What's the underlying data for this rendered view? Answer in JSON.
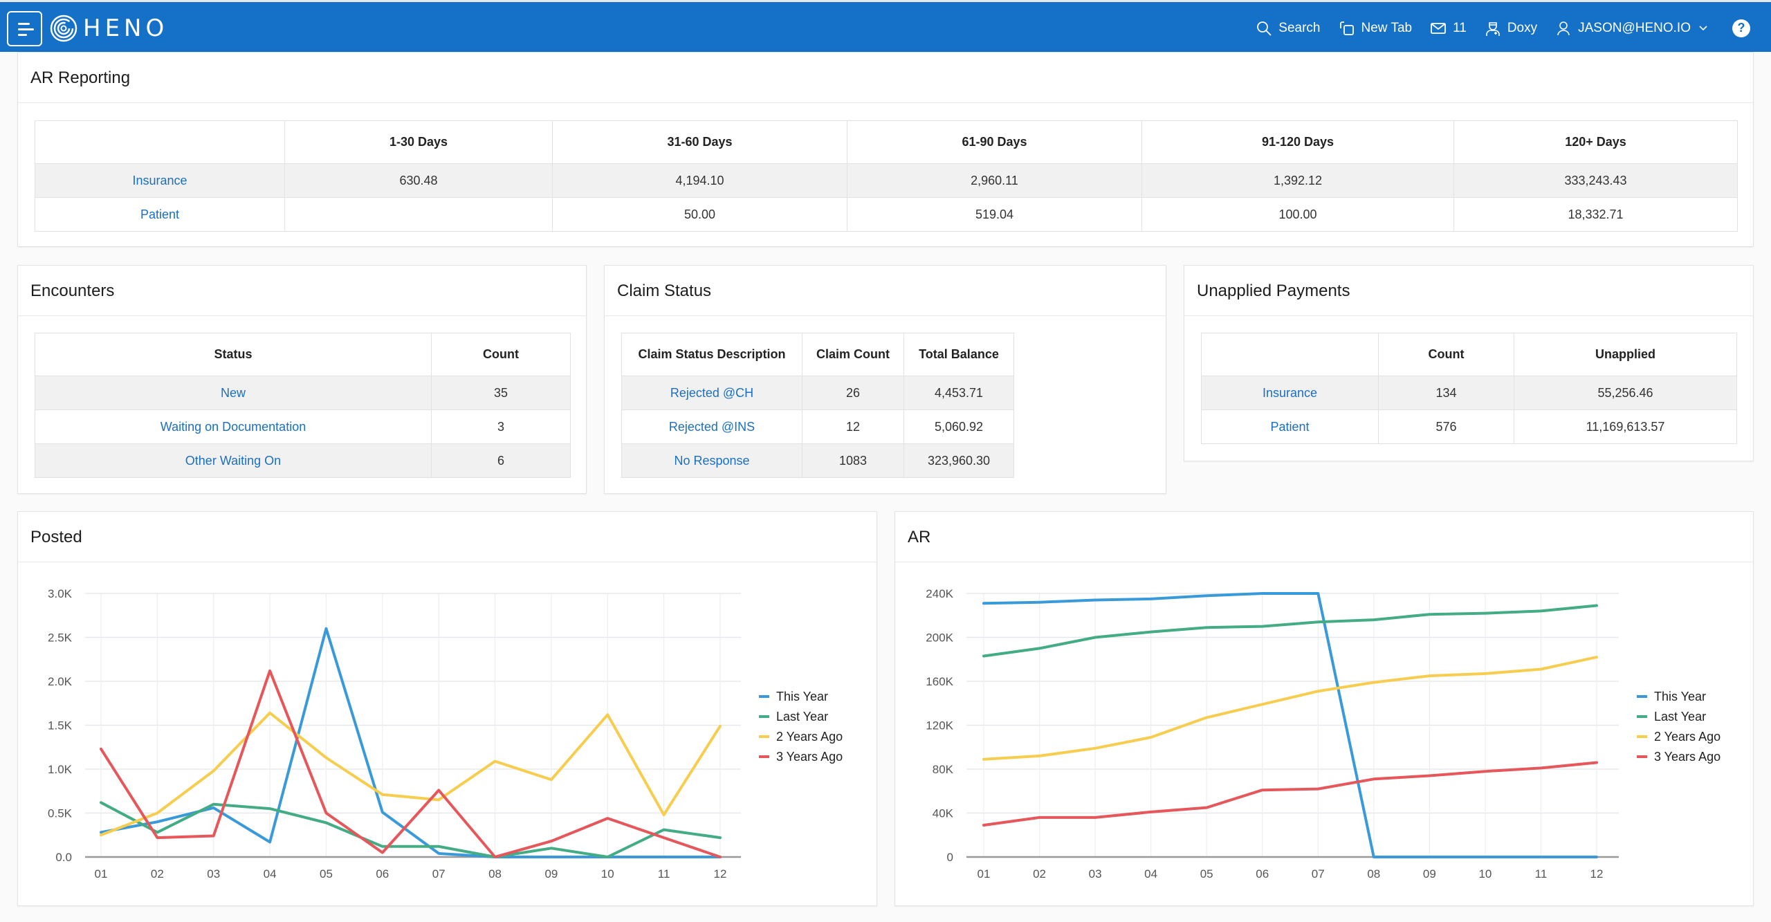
{
  "header": {
    "brand": "HENO",
    "nav": {
      "search": "Search",
      "new_tab": "New Tab",
      "messages_count": "11",
      "doxy": "Doxy",
      "user": "JASON@HENO.IO",
      "help": "?"
    },
    "brand_color": "#1570c7"
  },
  "ar_reporting": {
    "title": "AR Reporting",
    "columns": [
      "",
      "1-30 Days",
      "31-60 Days",
      "61-90 Days",
      "91-120 Days",
      "120+ Days"
    ],
    "rows": [
      {
        "label": "Insurance",
        "values": [
          "630.48",
          "4,194.10",
          "2,960.11",
          "1,392.12",
          "333,243.43"
        ]
      },
      {
        "label": "Patient",
        "values": [
          "",
          "50.00",
          "519.04",
          "100.00",
          "18,332.71"
        ]
      }
    ]
  },
  "encounters": {
    "title": "Encounters",
    "columns": [
      "Status",
      "Count"
    ],
    "rows": [
      {
        "status": "New",
        "count": "35"
      },
      {
        "status": "Waiting on Documentation",
        "count": "3"
      },
      {
        "status": "Other Waiting On",
        "count": "6"
      }
    ]
  },
  "claim_status": {
    "title": "Claim Status",
    "columns": [
      "Claim Status Description",
      "Claim Count",
      "Total Balance"
    ],
    "rows": [
      {
        "description": "Rejected @CH",
        "count": "26",
        "balance": "4,453.71"
      },
      {
        "description": "Rejected @INS",
        "count": "12",
        "balance": "5,060.92"
      },
      {
        "description": "No Response",
        "count": "1083",
        "balance": "323,960.30"
      }
    ]
  },
  "unapplied_payments": {
    "title": "Unapplied Payments",
    "columns": [
      "",
      "Count",
      "Unapplied"
    ],
    "rows": [
      {
        "label": "Insurance",
        "count": "134",
        "unapplied": "55,256.46"
      },
      {
        "label": "Patient",
        "count": "576",
        "unapplied": "11,169,613.57"
      }
    ]
  },
  "chart_data": [
    {
      "id": "posted",
      "type": "line",
      "title": "Posted",
      "xlabel": "",
      "ylabel": "",
      "x": [
        "01",
        "02",
        "03",
        "04",
        "05",
        "06",
        "07",
        "08",
        "09",
        "10",
        "11",
        "12"
      ],
      "ylim": [
        0,
        3000
      ],
      "yticks": [
        0,
        500,
        1000,
        1500,
        2000,
        2500,
        3000
      ],
      "ytick_labels": [
        "0.0",
        "0.5K",
        "1.0K",
        "1.5K",
        "2.0K",
        "2.5K",
        "3.0K"
      ],
      "grid": true,
      "legend_position": "right",
      "series": [
        {
          "name": "This Year",
          "color": "#3a9ad9",
          "values": [
            280,
            400,
            560,
            170,
            2600,
            510,
            40,
            0,
            0,
            0,
            0,
            0
          ]
        },
        {
          "name": "Last Year",
          "color": "#43ac84",
          "values": [
            620,
            280,
            600,
            550,
            390,
            120,
            120,
            0,
            100,
            0,
            310,
            220
          ]
        },
        {
          "name": "2 Years Ago",
          "color": "#f7cd50",
          "values": [
            250,
            500,
            980,
            1640,
            1130,
            710,
            650,
            1090,
            880,
            1620,
            480,
            1490
          ]
        },
        {
          "name": "3 Years Ago",
          "color": "#e5575a",
          "values": [
            1230,
            220,
            240,
            2120,
            500,
            50,
            760,
            0,
            180,
            440,
            220,
            0
          ]
        }
      ]
    },
    {
      "id": "ar",
      "type": "line",
      "title": "AR",
      "xlabel": "",
      "ylabel": "",
      "x": [
        "01",
        "02",
        "03",
        "04",
        "05",
        "06",
        "07",
        "08",
        "09",
        "10",
        "11",
        "12"
      ],
      "ylim": [
        0,
        240000
      ],
      "yticks": [
        0,
        40000,
        80000,
        120000,
        160000,
        200000,
        240000
      ],
      "ytick_labels": [
        "0",
        "40K",
        "80K",
        "120K",
        "160K",
        "200K",
        "240K"
      ],
      "grid": true,
      "legend_position": "right",
      "series": [
        {
          "name": "This Year",
          "color": "#3a9ad9",
          "values": [
            231000,
            232000,
            234000,
            235000,
            238000,
            240000,
            240000,
            0,
            0,
            0,
            0,
            0
          ]
        },
        {
          "name": "Last Year",
          "color": "#43ac84",
          "values": [
            183000,
            190000,
            200000,
            205000,
            209000,
            210000,
            214000,
            216000,
            221000,
            222000,
            224000,
            229000
          ]
        },
        {
          "name": "2 Years Ago",
          "color": "#f7cd50",
          "values": [
            89000,
            92000,
            99000,
            109000,
            127000,
            139000,
            151000,
            159000,
            165000,
            167000,
            171000,
            182000
          ]
        },
        {
          "name": "3 Years Ago",
          "color": "#e5575a",
          "values": [
            29000,
            36000,
            36000,
            41000,
            45000,
            61000,
            62000,
            71000,
            74000,
            78000,
            81000,
            86000
          ]
        }
      ]
    }
  ]
}
